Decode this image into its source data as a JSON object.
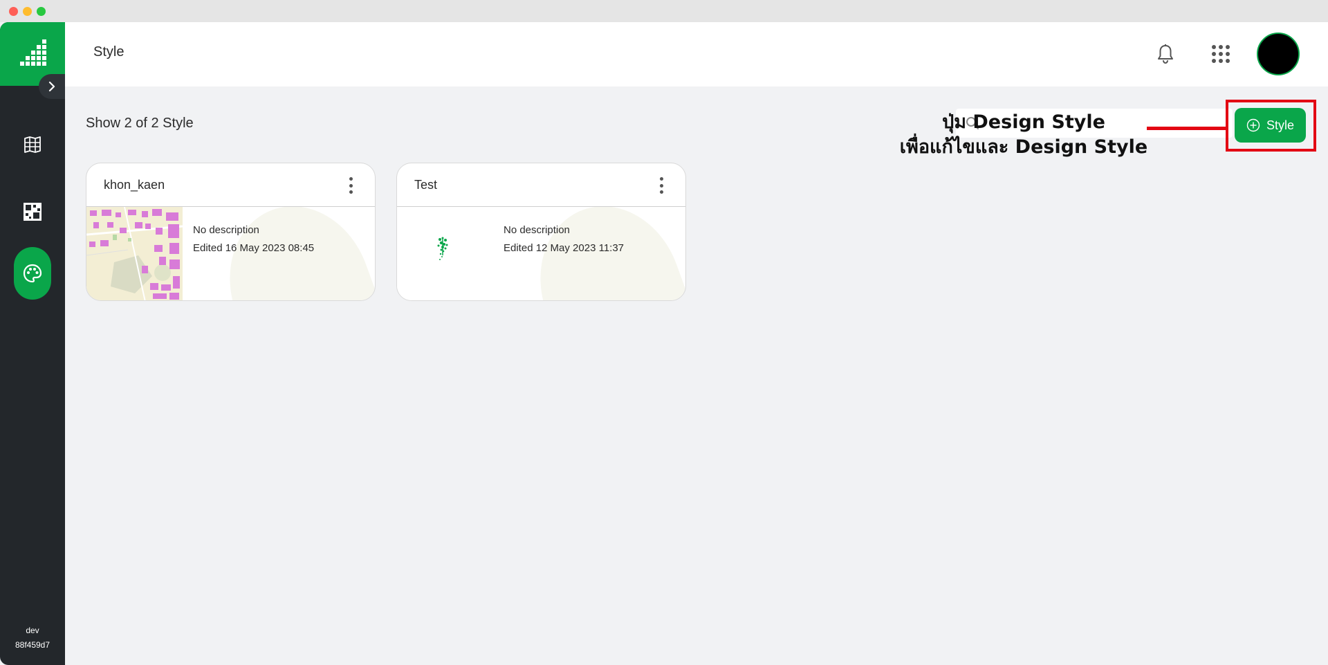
{
  "window": {
    "controls": [
      "close",
      "minimize",
      "maximize"
    ]
  },
  "sidebar": {
    "logo_icon": "signal-bars-logo-icon",
    "expand_icon": "chevron-right-icon",
    "items": [
      {
        "name": "map",
        "icon": "map-grid-icon",
        "active": false
      },
      {
        "name": "dashboard",
        "icon": "grid-layout-icon",
        "active": false
      },
      {
        "name": "style",
        "icon": "palette-icon",
        "active": true
      }
    ],
    "version_label": "dev",
    "version_hash": "88f459d7"
  },
  "header": {
    "title": "Style",
    "notification_icon": "bell-icon",
    "apps_icon": "apps-grid-icon"
  },
  "content": {
    "count_text": "Show 2 of 2 Style",
    "search": {
      "placeholder": ""
    },
    "add_button_label": "Style",
    "callout": {
      "line1": "ปุ่ม Design Style",
      "line2": "เพื่อแก้ไขและ Design Style"
    },
    "cards": [
      {
        "title": "khon_kaen",
        "description": "No description",
        "edited": "Edited 16 May 2023 08:45"
      },
      {
        "title": "Test",
        "description": "No description",
        "edited": "Edited 12 May 2023 11:37"
      }
    ]
  },
  "colors": {
    "brand_green": "#0aa64a",
    "sidebar_dark": "#23272b",
    "highlight_red": "#e30613"
  }
}
